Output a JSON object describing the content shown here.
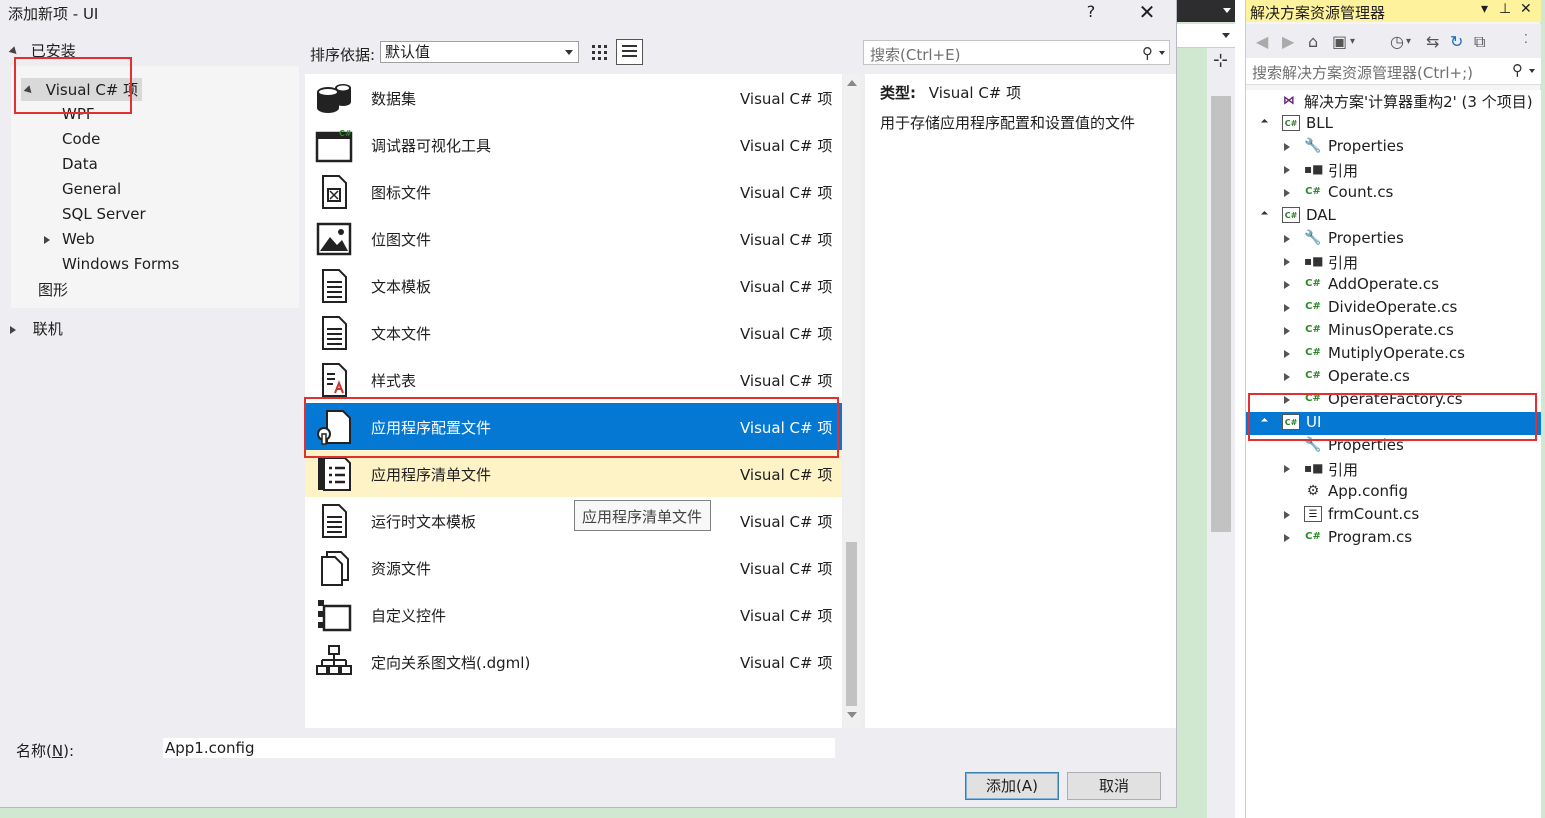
{
  "dialog": {
    "title": "添加新项 - UI",
    "help": "?",
    "close": "✕",
    "tree": {
      "installed": "已安装",
      "visual_csharp": "Visual C# 项",
      "children": [
        "WPF",
        "Code",
        "Data",
        "General",
        "SQL Server",
        "Web",
        "Windows Forms"
      ],
      "graphics": "图形",
      "online": "联机"
    },
    "sort_label": "排序依据:",
    "sort_value": "默认值",
    "search_placeholder": "搜索(Ctrl+E)",
    "templates": [
      {
        "name": "数据集",
        "lang": "Visual C# 项",
        "icon": "dataset-icon"
      },
      {
        "name": "调试器可视化工具",
        "lang": "Visual C# 项",
        "icon": "debugger-visualizer-icon"
      },
      {
        "name": "图标文件",
        "lang": "Visual C# 项",
        "icon": "icon-file-icon"
      },
      {
        "name": "位图文件",
        "lang": "Visual C# 项",
        "icon": "bitmap-icon"
      },
      {
        "name": "文本模板",
        "lang": "Visual C# 项",
        "icon": "text-template-icon"
      },
      {
        "name": "文本文件",
        "lang": "Visual C# 项",
        "icon": "text-file-icon"
      },
      {
        "name": "样式表",
        "lang": "Visual C# 项",
        "icon": "stylesheet-icon"
      },
      {
        "name": "应用程序配置文件",
        "lang": "Visual C# 项",
        "icon": "app-config-icon"
      },
      {
        "name": "应用程序清单文件",
        "lang": "Visual C# 项",
        "icon": "app-manifest-icon"
      },
      {
        "name": "运行时文本模板",
        "lang": "Visual C# 项",
        "icon": "runtime-template-icon"
      },
      {
        "name": "资源文件",
        "lang": "Visual C# 项",
        "icon": "resource-file-icon"
      },
      {
        "name": "自定义控件",
        "lang": "Visual C# 项",
        "icon": "custom-control-icon"
      },
      {
        "name": "定向关系图文档(.dgml)",
        "lang": "Visual C# 项",
        "icon": "dgml-icon"
      }
    ],
    "tooltip": "应用程序清单文件",
    "description": {
      "type_label": "类型:",
      "type_value": "Visual C# 项",
      "text": "用于存储应用程序配置和设置值的文件"
    },
    "name_label_prefix": "名称(",
    "name_label_key": "N",
    "name_label_suffix": "):",
    "name_value": "App1.config",
    "add_button": "添加(A)",
    "cancel_button": "取消"
  },
  "solution_explorer": {
    "title": "解决方案资源管理器",
    "title_controls": [
      "▾",
      "⊥",
      "✕"
    ],
    "search_placeholder": "搜索解决方案资源管理器(Ctrl+;)",
    "nodes": [
      {
        "label": "解决方案'计算器重构2' (3 个项目)",
        "depth": 0,
        "expander": "none",
        "icon": "solution-icon"
      },
      {
        "label": "BLL",
        "depth": 1,
        "expander": "open",
        "icon": "csharp-project-icon"
      },
      {
        "label": "Properties",
        "depth": 2,
        "expander": "closed",
        "icon": "wrench-icon"
      },
      {
        "label": "引用",
        "depth": 2,
        "expander": "closed",
        "icon": "references-icon"
      },
      {
        "label": "Count.cs",
        "depth": 2,
        "expander": "closed",
        "icon": "csharp-file-icon"
      },
      {
        "label": "DAL",
        "depth": 1,
        "expander": "open",
        "icon": "csharp-project-icon"
      },
      {
        "label": "Properties",
        "depth": 2,
        "expander": "closed",
        "icon": "wrench-icon"
      },
      {
        "label": "引用",
        "depth": 2,
        "expander": "closed",
        "icon": "references-icon"
      },
      {
        "label": "AddOperate.cs",
        "depth": 2,
        "expander": "closed",
        "icon": "csharp-file-icon"
      },
      {
        "label": "DivideOperate.cs",
        "depth": 2,
        "expander": "closed",
        "icon": "csharp-file-icon"
      },
      {
        "label": "MinusOperate.cs",
        "depth": 2,
        "expander": "closed",
        "icon": "csharp-file-icon"
      },
      {
        "label": "MutiplyOperate.cs",
        "depth": 2,
        "expander": "closed",
        "icon": "csharp-file-icon"
      },
      {
        "label": "Operate.cs",
        "depth": 2,
        "expander": "closed",
        "icon": "csharp-file-icon"
      },
      {
        "label": "OperateFactory.cs",
        "depth": 2,
        "expander": "closed",
        "icon": "csharp-file-icon"
      },
      {
        "label": "UI",
        "depth": 1,
        "expander": "open",
        "icon": "csharp-project-icon"
      },
      {
        "label": "Properties",
        "depth": 2,
        "expander": "none",
        "icon": "wrench-icon"
      },
      {
        "label": "引用",
        "depth": 2,
        "expander": "closed",
        "icon": "references-icon"
      },
      {
        "label": "App.config",
        "depth": 2,
        "expander": "none",
        "icon": "config-file-icon"
      },
      {
        "label": "frmCount.cs",
        "depth": 2,
        "expander": "closed",
        "icon": "form-icon"
      },
      {
        "label": "Program.cs",
        "depth": 2,
        "expander": "closed",
        "icon": "csharp-file-icon"
      }
    ]
  },
  "colors": {
    "selection": "#0578d4",
    "hover": "#fef3c6",
    "highlight_box": "#e03030",
    "title_bar": "#fff29d",
    "editor_bg": "#cfe8cf"
  }
}
